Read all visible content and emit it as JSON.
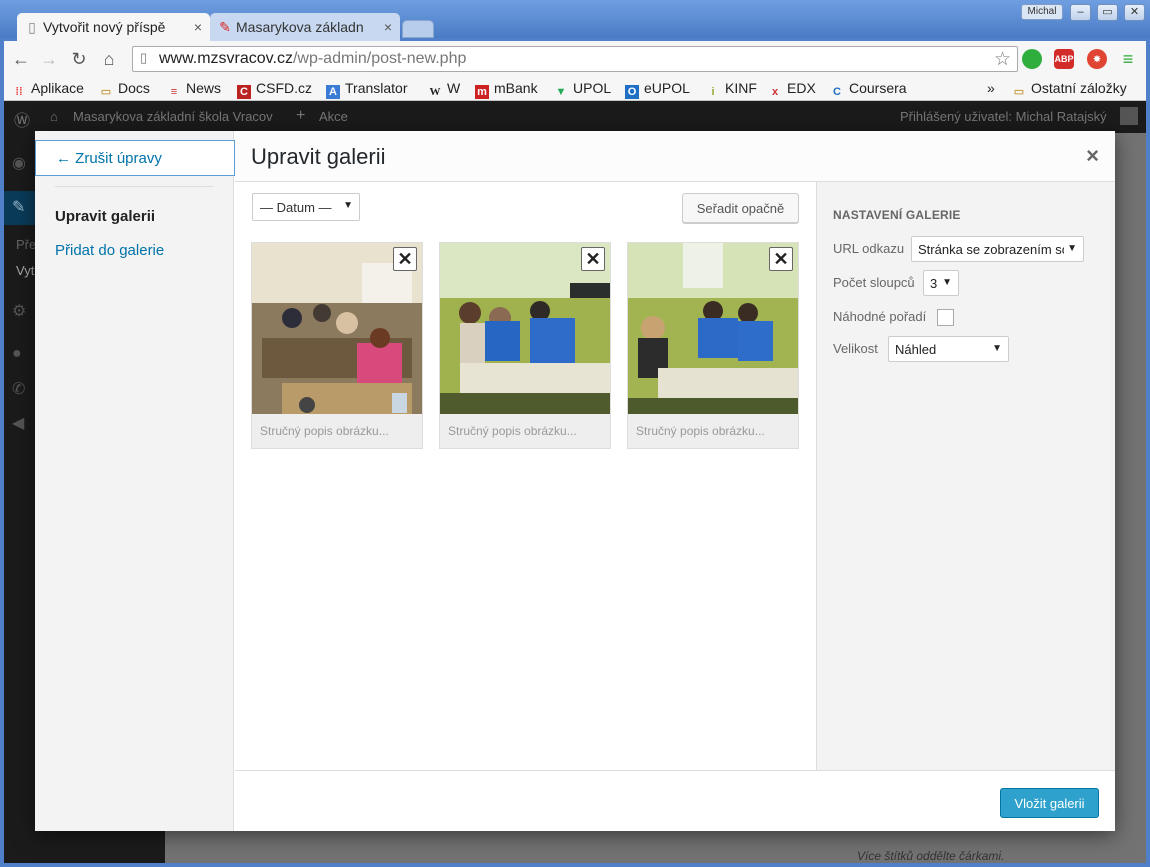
{
  "browser": {
    "tabs": [
      {
        "title": "Vytvořit nový příspě",
        "icon": "page-icon"
      },
      {
        "title": "Masarykova základn",
        "icon": "pencil-icon"
      }
    ],
    "user": "Michal",
    "url_host": "www.mzsvracov.cz",
    "url_path": "/wp-admin/post-new.php",
    "bookmarks": [
      "Aplikace",
      "Docs",
      "News",
      "CSFD.cz",
      "Translator",
      "W",
      "mBank",
      "UPOL",
      "eUPOL",
      "KINF",
      "EDX",
      "Coursera"
    ],
    "bookmarks_more": "»",
    "other_bookmarks": "Ostatní záložky",
    "extensions": {
      "abp": "ABP"
    }
  },
  "wp": {
    "site_name": "Masarykova základní škola Vracov",
    "new_label": "Akce",
    "logged_user": "Přihlášený uživatel: Michal Ratajský",
    "menu_sub1": "Pře",
    "menu_sub2": "Vyt",
    "bg_hint": "Více štítků oddělte čárkami."
  },
  "modal": {
    "cancel_label": "← Zrušit úpravy",
    "side_active": "Upravit galerii",
    "side_add": "Přidat do galerie",
    "title": "Upravit galerii",
    "close": "×",
    "sort_select": "— Datum —",
    "reverse_button": "Seřadit opačně",
    "images": [
      {
        "caption_placeholder": "Stručný popis obrázku..."
      },
      {
        "caption_placeholder": "Stručný popis obrázku..."
      },
      {
        "caption_placeholder": "Stručný popis obrázku..."
      }
    ],
    "remove_symbol": "✕",
    "settings": {
      "heading": "NASTAVENÍ GALERIE",
      "link_label": "URL odkazu",
      "link_value": "Stránka se zobrazením so",
      "columns_label": "Počet sloupců",
      "columns_value": "3",
      "random_label": "Náhodné pořadí",
      "random_checked": false,
      "size_label": "Velikost",
      "size_value": "Náhled"
    },
    "insert_button": "Vložit galerii"
  },
  "colors": {
    "primary_button": "#2ea2cc",
    "link": "#0073aa",
    "chrome_frame": "#4f80c9"
  }
}
